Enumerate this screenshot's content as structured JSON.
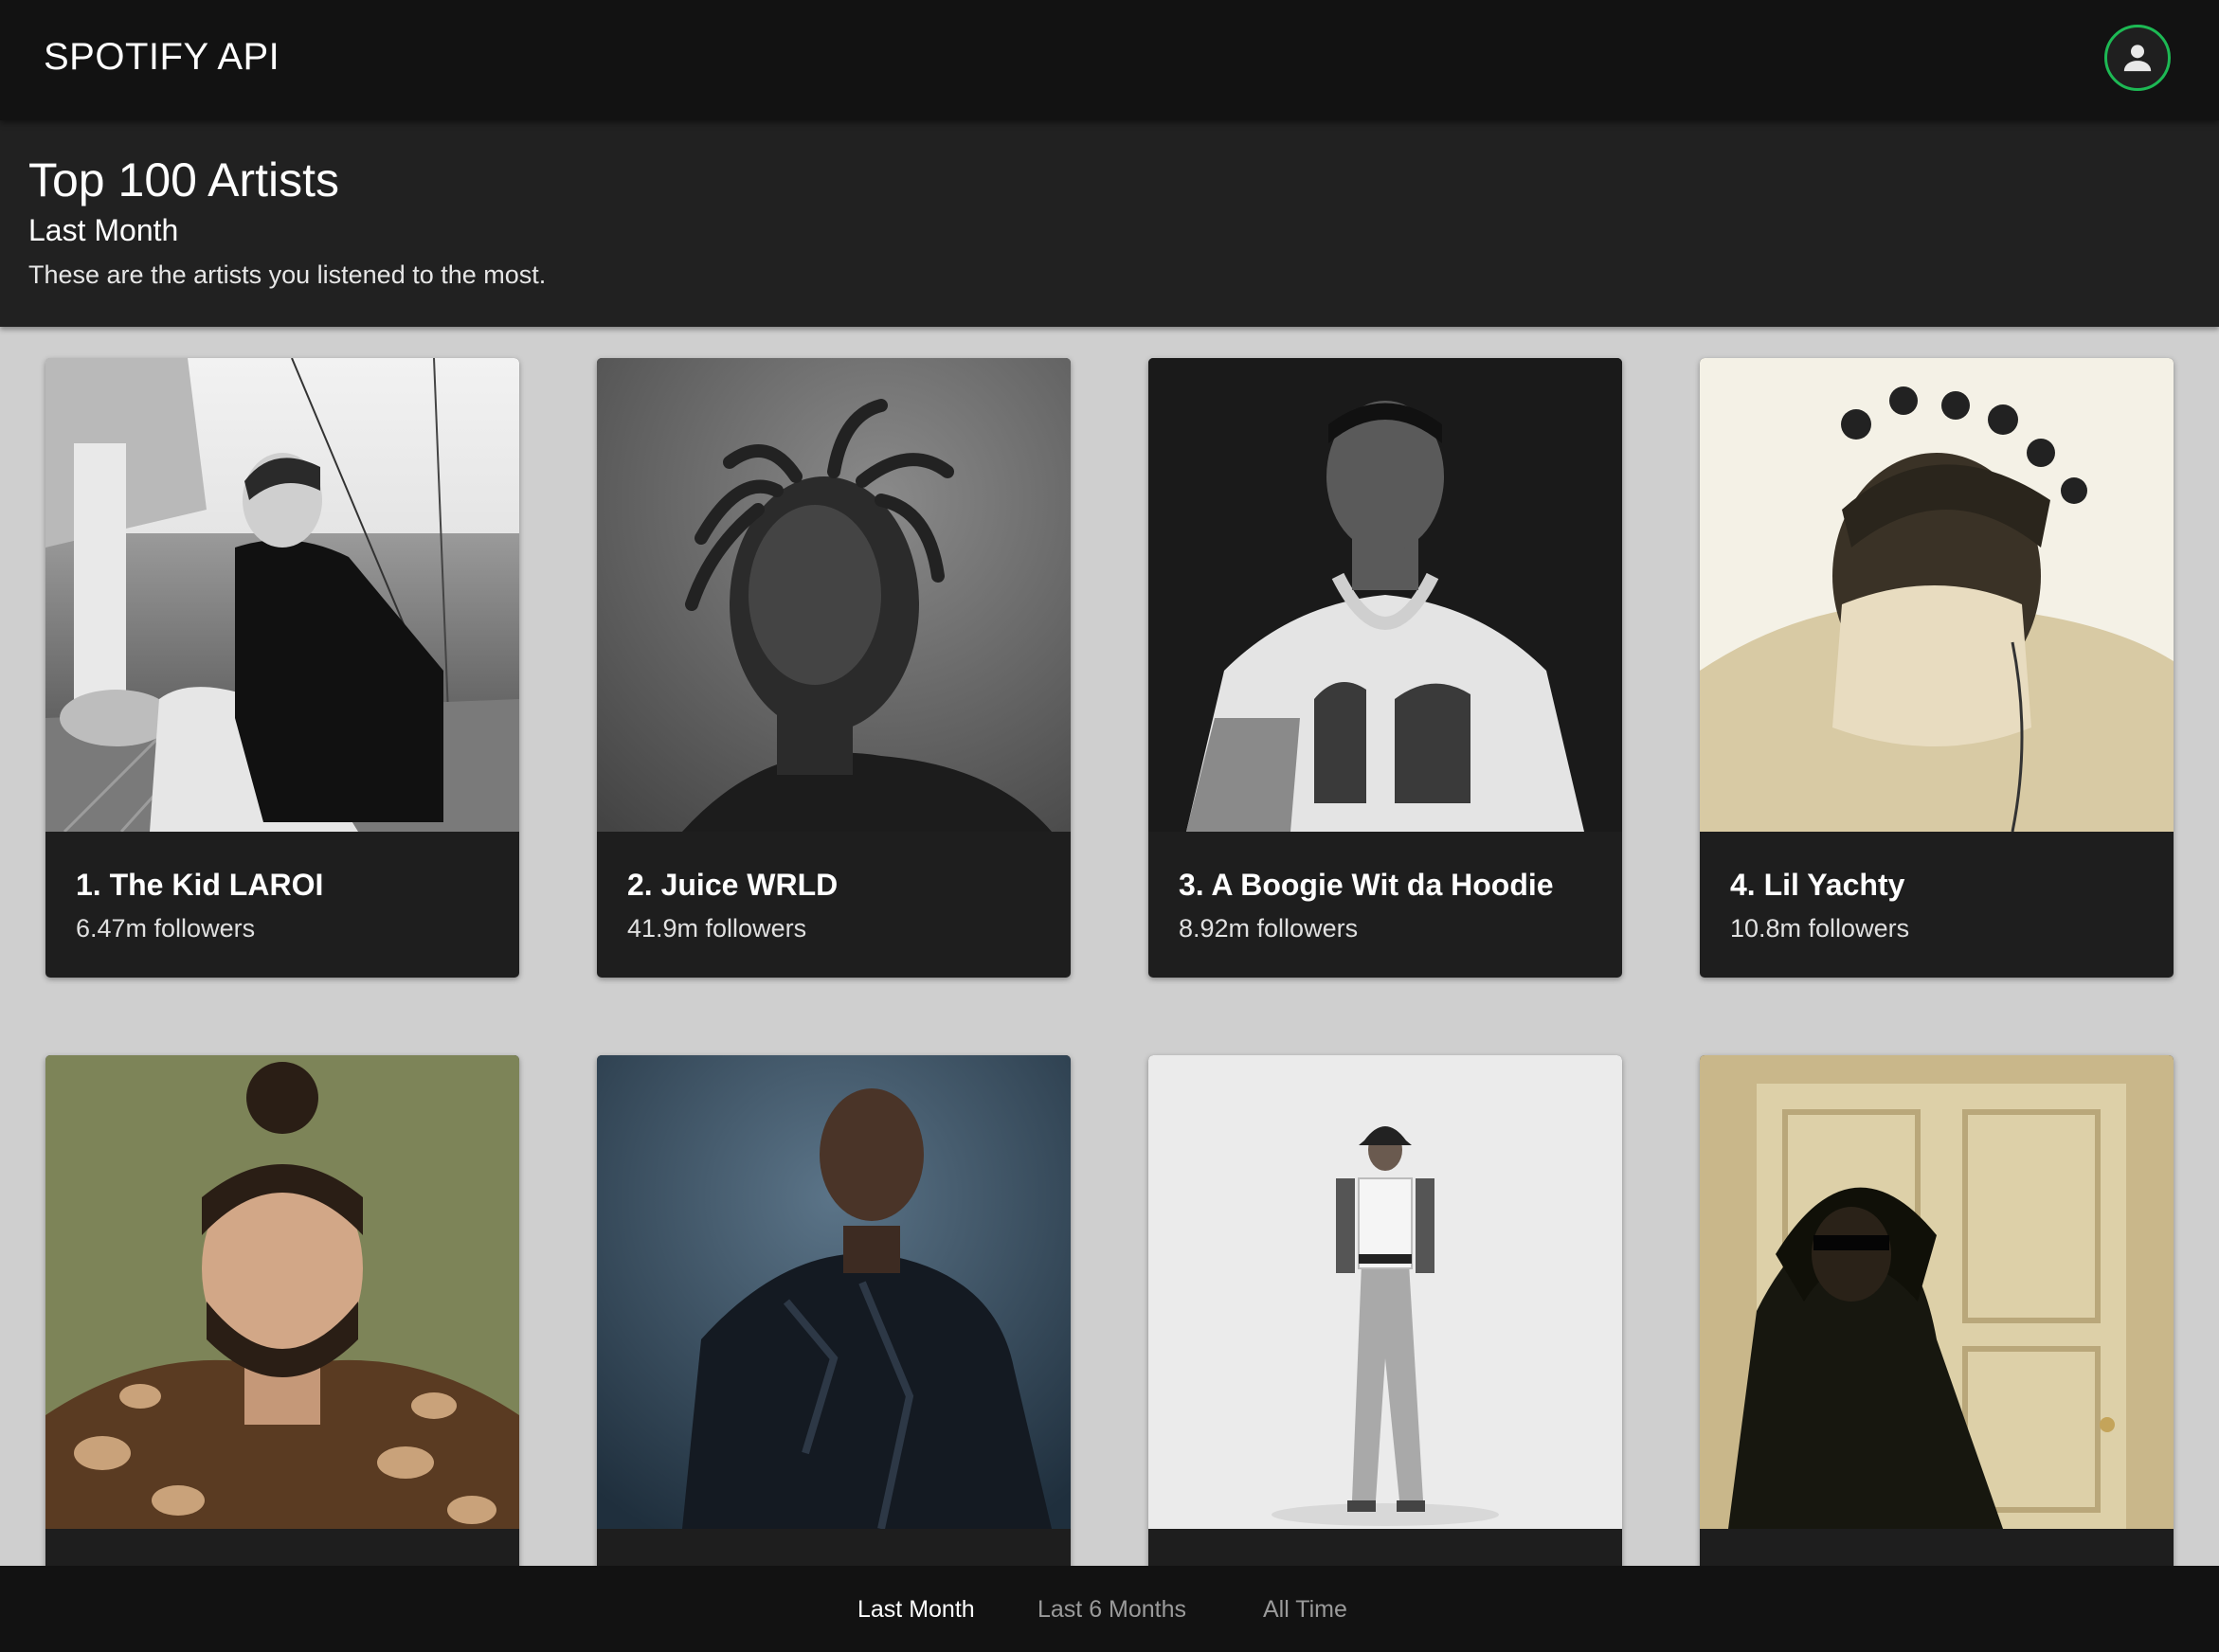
{
  "app": {
    "title": "SPOTIFY API"
  },
  "header": {
    "title": "Top 100 Artists",
    "subtitle": "Last Month",
    "description": "These are the artists you listened to the most."
  },
  "artists": [
    {
      "rank_name": "1. The Kid LAROI",
      "followers": "6.47m followers"
    },
    {
      "rank_name": "2. Juice WRLD",
      "followers": "41.9m followers"
    },
    {
      "rank_name": "3. A Boogie Wit da Hoodie",
      "followers": "8.92m followers"
    },
    {
      "rank_name": "4. Lil Yachty",
      "followers": "10.8m followers"
    },
    {
      "rank_name": "",
      "followers": ""
    },
    {
      "rank_name": "",
      "followers": ""
    },
    {
      "rank_name": "",
      "followers": ""
    },
    {
      "rank_name": "",
      "followers": ""
    }
  ],
  "nav": {
    "items": [
      {
        "label": "Last Month",
        "active": true
      },
      {
        "label": "Last 6 Months",
        "active": false
      },
      {
        "label": "All Time",
        "active": false
      }
    ]
  },
  "icons": {
    "account": "user-icon"
  },
  "colors": {
    "accent": "#1db954",
    "topbar": "#121212",
    "panel": "#212121",
    "background": "#cfcfcf"
  }
}
